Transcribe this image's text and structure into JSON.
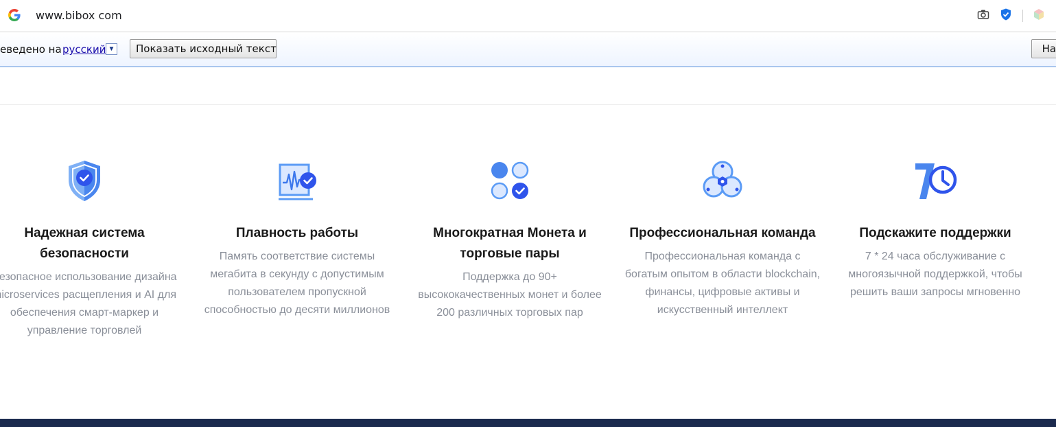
{
  "browser": {
    "url": "www.bibox com"
  },
  "translate_bar": {
    "translated_to": "еведено на",
    "language": "русский",
    "show_original": "Показать исходный текст",
    "settings": "Нас"
  },
  "features": [
    {
      "icon": "shield-check-icon",
      "title": "Надежная система безопасности",
      "description": "Безопасное использование дизайна microservices расщепления и AI для обеспечения смарт-маркер и управление торговлей"
    },
    {
      "icon": "waveform-check-icon",
      "title": "Плавность работы",
      "description": "Память соответствие системы мегабита в секунду с допустимым пользователем пропускной способностью до десяти миллионов"
    },
    {
      "icon": "coins-check-icon",
      "title": "Многократная Монета и торговые пары",
      "description": "Поддержка до 90+ высококачественных монет и более 200 различных торговых пар"
    },
    {
      "icon": "team-icon",
      "title": "Профессиональная команда",
      "description": "Профессиональная команда с богатым опытом в области blockchain, финансы, цифровые активы и искусственный интеллект"
    },
    {
      "icon": "clock-7-icon",
      "title": "Подскажите поддержки",
      "description": "7 * 24 часа обслуживание с многоязычной поддержкой, чтобы решить ваши запросы мгновенно"
    }
  ],
  "colors": {
    "accent": "#2f54eb",
    "accent_light": "#5b9bf5",
    "text_dark": "#1a1a1a",
    "text_muted": "#8a8f99",
    "footer": "#1b2a4e"
  }
}
